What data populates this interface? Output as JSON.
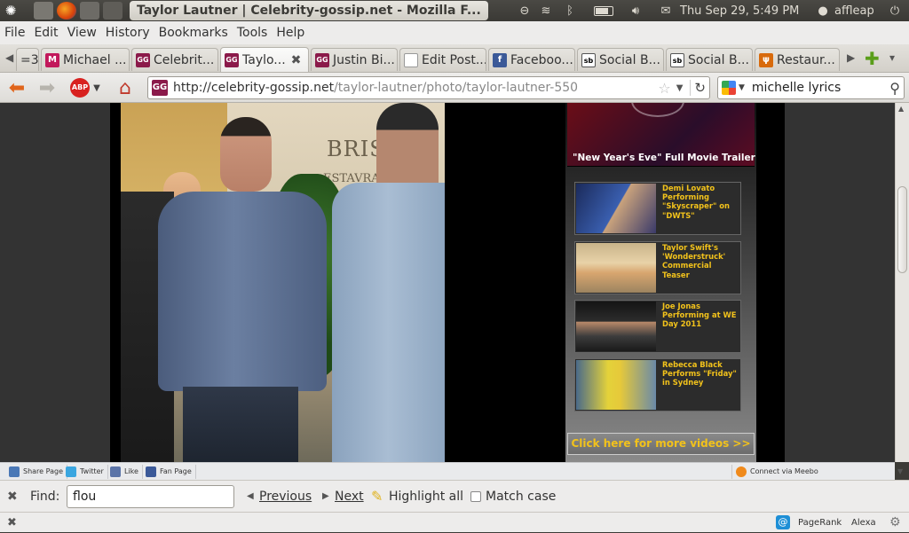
{
  "panel": {
    "window_title": "Taylor Lautner | Celebrity-gossip.net - Mozilla F...",
    "datetime": "Thu Sep 29,  5:49 PM",
    "user": "affleap"
  },
  "menubar": {
    "items": [
      "File",
      "Edit",
      "View",
      "History",
      "Bookmarks",
      "Tools",
      "Help"
    ]
  },
  "tabs": {
    "overflow_count": "=3",
    "items": [
      {
        "label": "Michael ...",
        "icon": "M"
      },
      {
        "label": "Celebrit...",
        "icon": "GG"
      },
      {
        "label": "Taylo...",
        "icon": "GG"
      },
      {
        "label": "Justin Bi...",
        "icon": "GG"
      },
      {
        "label": "Edit Post...",
        "icon": "page"
      },
      {
        "label": "Faceboo...",
        "icon": "f"
      },
      {
        "label": "Social B...",
        "icon": "sb"
      },
      {
        "label": "Social B...",
        "icon": "sb"
      },
      {
        "label": "Restaur...",
        "icon": "fork"
      }
    ]
  },
  "navbar": {
    "url_host": "http://celebrity-gossip.net",
    "url_path": "/taylor-lautner/photo/taylor-lautner-550",
    "search_value": "michelle lyrics"
  },
  "sidebar": {
    "featured_caption": "\"New Year's Eve\" Full Movie Trailer",
    "videos": [
      {
        "title": "Demi Lovato Performing \"Skyscraper\" on \"DWTS\""
      },
      {
        "title": "Taylor Swift's 'Wonderstruck' Commercial Teaser"
      },
      {
        "title": "Joe Jonas Performing at WE Day 2011"
      },
      {
        "title": "Rebecca Black Performs \"Friday\" in Sydney"
      }
    ],
    "more_videos": "Click here for more videos >>"
  },
  "photo_sign": {
    "line1": "BRISTO",
    "line2": "ESTAVRANT"
  },
  "meebo": {
    "share": "Share Page",
    "twitter": "Twitter",
    "like": "Like",
    "fan": "Fan Page",
    "connect": "Connect via Meebo"
  },
  "findbar": {
    "label": "Find:",
    "value": "flou",
    "previous": "Previous",
    "next": "Next",
    "highlight": "Highlight all",
    "match_case": "Match case"
  },
  "statusbar": {
    "pagerank": "PageRank",
    "alexa": "Alexa"
  },
  "colors": {
    "sidebar_accent": "#f2c21b",
    "tab_gg": "#8b1a4a",
    "facebook": "#3b5998"
  }
}
